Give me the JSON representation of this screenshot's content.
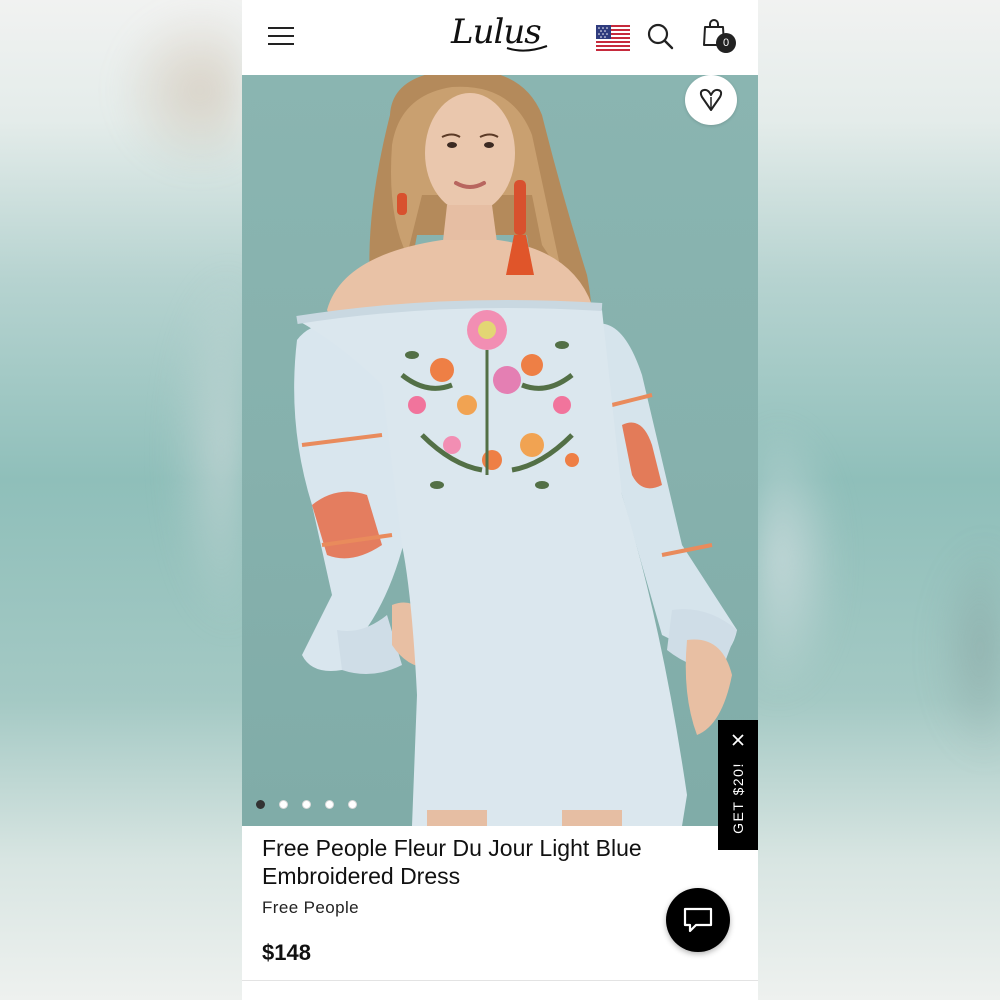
{
  "header": {
    "logo_text": "Lulus",
    "menu_icon": "hamburger-menu-icon",
    "flag_icon": "us-flag-icon",
    "search_icon": "search-icon",
    "bag_icon": "shopping-bag-icon",
    "bag_count": "0"
  },
  "gallery": {
    "wishlist_icon": "heart-icon",
    "image_count": 5,
    "active_index": 0
  },
  "promo": {
    "label": "GET $20!",
    "close_icon": "close-icon"
  },
  "product": {
    "title": "Free People Fleur Du Jour Light Blue Embroidered Dress",
    "brand": "Free People",
    "price": "$148"
  },
  "chat": {
    "icon": "chat-bubble-icon"
  },
  "colors": {
    "background_teal": "#8ab5b1",
    "dress_blue": "#dbe7ee",
    "text": "#111111",
    "black": "#000000"
  }
}
